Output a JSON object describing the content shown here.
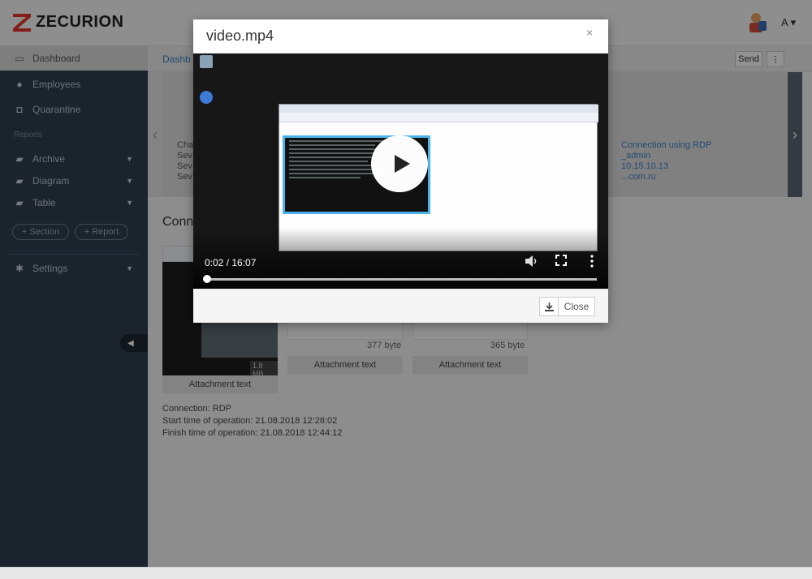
{
  "app": {
    "logo_text": "ZECURION",
    "brand_color": "#e4352b",
    "user_menu": "A"
  },
  "sidebar": {
    "items": [
      {
        "label": "Dashboard",
        "icon": "monitor-icon"
      },
      {
        "label": "Employees",
        "icon": "user-icon"
      },
      {
        "label": "Quarantine",
        "icon": "lock-icon"
      }
    ],
    "section_label": "Reports",
    "report_items": [
      {
        "label": "Archive",
        "icon": "folder-icon"
      },
      {
        "label": "Diagram",
        "icon": "folder-icon"
      },
      {
        "label": "Table",
        "icon": "folder-icon"
      }
    ],
    "buttons": [
      "+ Section",
      "+ Report"
    ],
    "settings_label": "Settings"
  },
  "main": {
    "breadcrumb": "Dashb",
    "send_label": "Send",
    "more_label": "⋮",
    "carousel_left": [
      "Cha",
      "Sev",
      "Sev",
      "Sev"
    ],
    "carousel_right": [
      "Connection using RDP",
      "_admin",
      "10.15.10.13",
      "...com.ru"
    ],
    "section_title": "Conn",
    "thumb_size": "1.8 MB",
    "attachments": [
      {
        "size": "",
        "label": "Attachment text"
      },
      {
        "size": "377 byte",
        "label": "Attachment text"
      },
      {
        "size": "365 byte",
        "label": "Attachment text"
      }
    ],
    "info": {
      "connection": "Connection: RDP",
      "start": "Start time of operation: 21.08.2018 12:28:02",
      "finish": "Finish time of operation: 21.08.2018 12:44:12"
    }
  },
  "modal": {
    "title": "video.mp4",
    "close_x": "×",
    "time": "0:02 / 16:07",
    "progress": 0.002,
    "close_label": "Close"
  }
}
